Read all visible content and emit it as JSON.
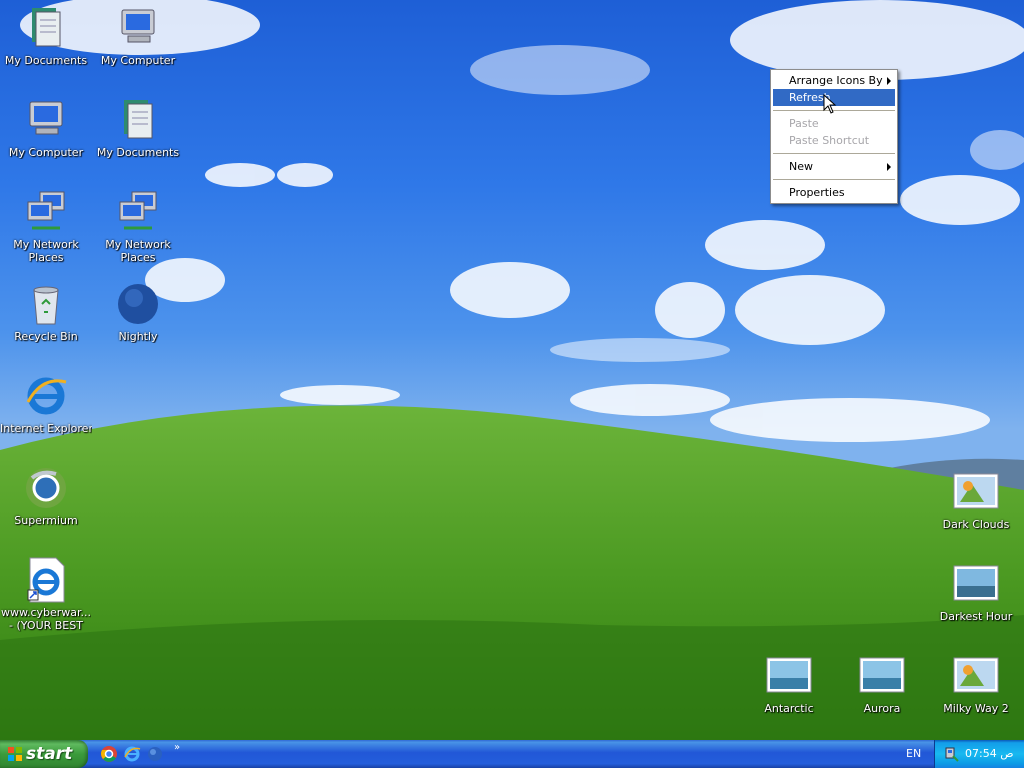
{
  "desktop": {
    "icons_left": [
      {
        "label": "My Documents",
        "icon": "my-documents-icon"
      },
      {
        "label": "My Computer",
        "icon": "my-computer-icon"
      },
      {
        "label": "My Computer",
        "icon": "my-computer-icon"
      },
      {
        "label": "My Documents",
        "icon": "my-documents-icon"
      },
      {
        "label": "My Network Places",
        "icon": "network-places-icon"
      },
      {
        "label": "My Network Places",
        "icon": "network-places-icon"
      },
      {
        "label": "Recycle Bin",
        "icon": "recycle-bin-icon"
      },
      {
        "label": "Nightly",
        "icon": "globe-icon"
      },
      {
        "label": "Internet Explorer",
        "icon": "internet-explorer-icon"
      },
      {
        "label": "Supermium",
        "icon": "supermium-icon"
      },
      {
        "label": "www.cyberwar... - (YOUR BEST S...",
        "icon": "internet-shortcut-icon"
      }
    ],
    "icons_right": [
      {
        "label": "Dark Clouds",
        "icon": "image-file-icon"
      },
      {
        "label": "Darkest Hour",
        "icon": "image-file-icon"
      },
      {
        "label": "Antarctic",
        "icon": "image-file-icon"
      },
      {
        "label": "Aurora",
        "icon": "image-file-icon"
      },
      {
        "label": "Milky Way 2",
        "icon": "image-file-icon"
      }
    ]
  },
  "context_menu": {
    "arrange": "Arrange Icons By",
    "refresh": "Refresh",
    "paste": "Paste",
    "paste_shortcut": "Paste Shortcut",
    "new": "New",
    "properties": "Properties"
  },
  "taskbar": {
    "start_label": "start",
    "quick_launch": [
      "chrome-icon",
      "internet-explorer-icon",
      "globe-icon"
    ],
    "more": "»",
    "language": "EN",
    "clock": "07:54 ص"
  },
  "colors": {
    "menu_highlight": "#316ac5",
    "taskbar": "#245edb",
    "start_button": "#3b9b3b",
    "tray": "#0c9ae6"
  }
}
